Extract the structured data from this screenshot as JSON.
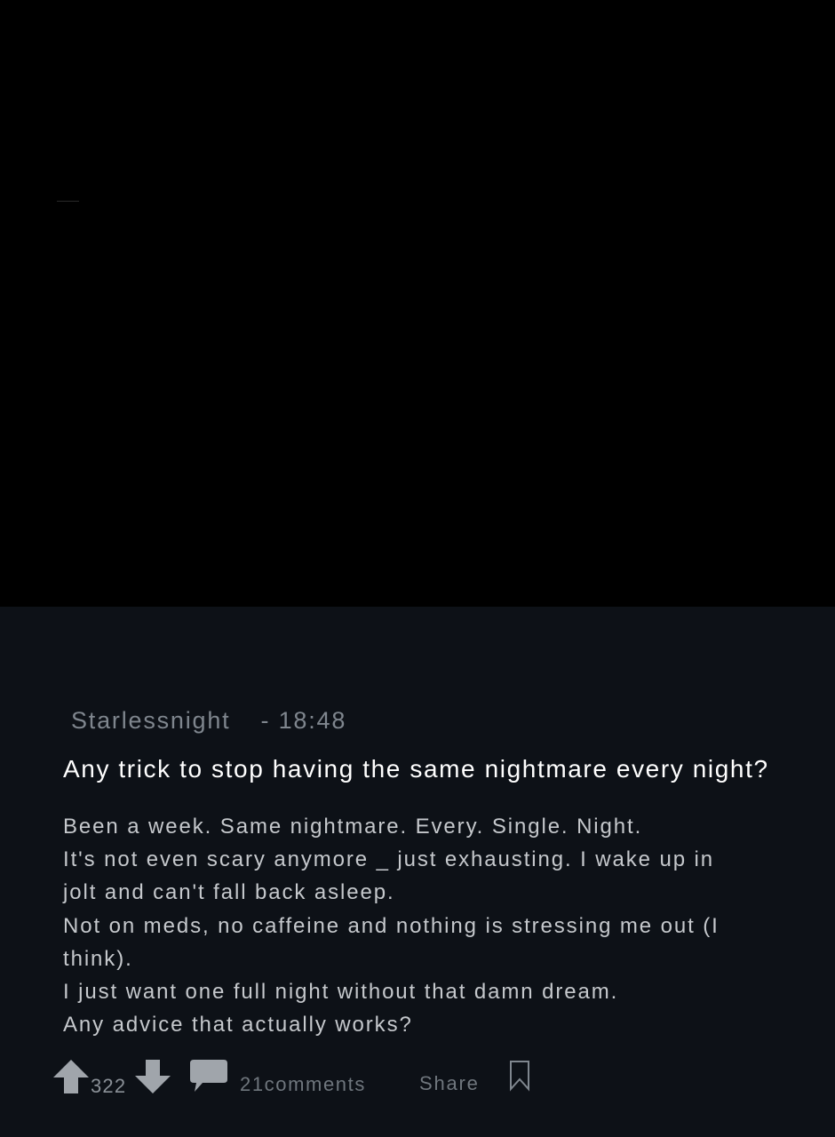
{
  "post": {
    "author": "Starlessnight",
    "time": "- 18:48",
    "title": "Any trick to stop having the same nightmare every night?",
    "body_lines": [
      "Been a week. Same nightmare. Every. Single. Night.",
      "It's not even scary anymore _ just exhausting. I wake up in",
      "jolt and can't fall back asleep.",
      "Not on meds, no caffeine and nothing is stressing me out (I",
      "think).",
      "I just want one full night without that damn dream.",
      "Any advice that actually works?"
    ]
  },
  "actions": {
    "upvote_icon": "arrow-up-icon",
    "score": "322",
    "downvote_icon": "arrow-down-icon",
    "comment_icon": "speech-bubble-icon",
    "comments_label": "21comments",
    "share_label": "Share",
    "bookmark_icon": "bookmark-icon"
  },
  "colors": {
    "top_area": "#000000",
    "post_background": "#0d1117",
    "title": "#ffffff",
    "body": "#c5c8cc",
    "muted": "#7f868e",
    "icon": "#a0a5ab"
  }
}
